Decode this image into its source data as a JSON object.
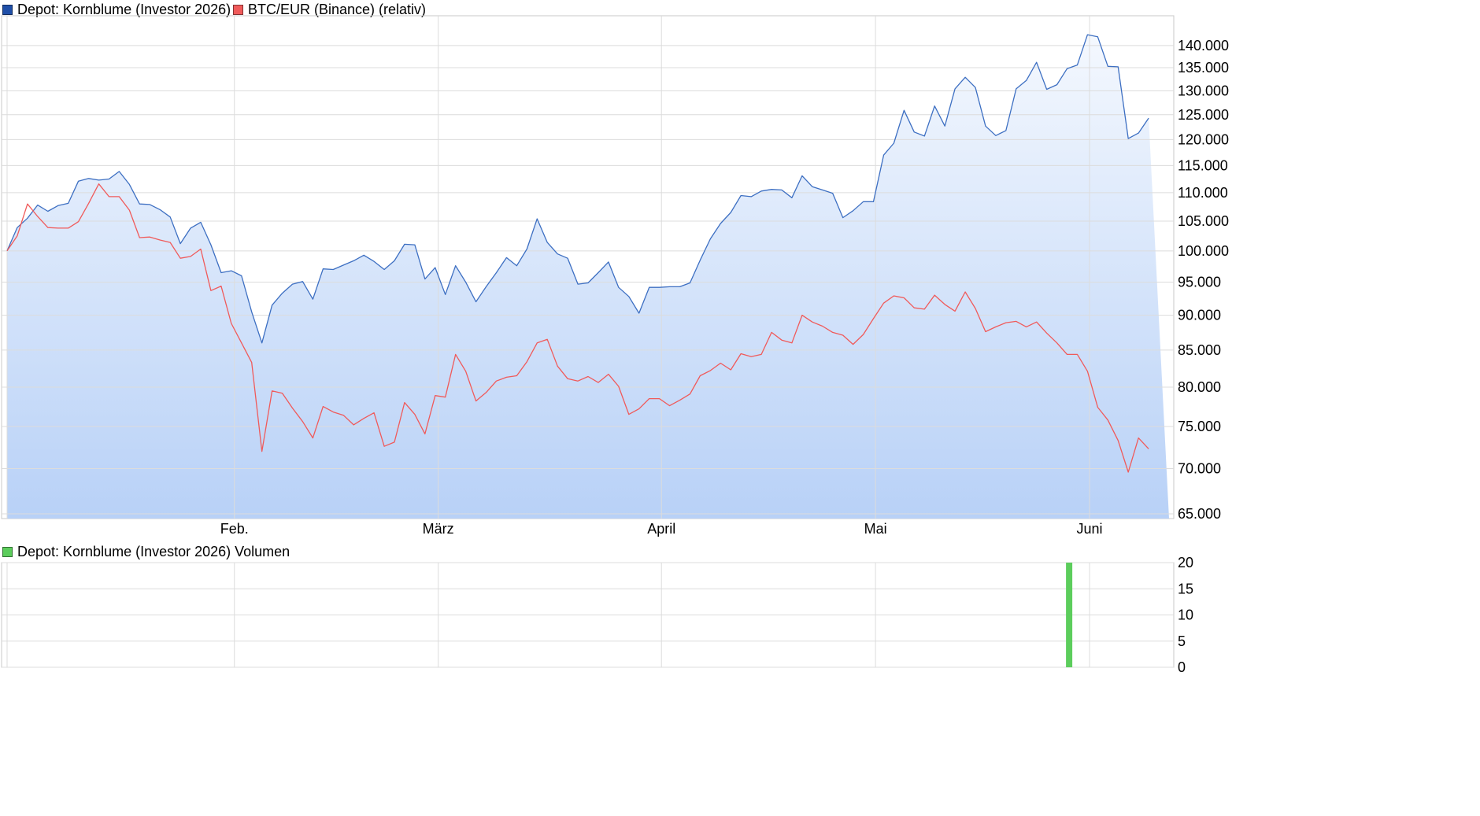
{
  "legend": {
    "depot": {
      "label": "Depot: Kornblume (Investor 2026)",
      "color": "#1f4fa8"
    },
    "btc": {
      "label": "BTC/EUR (Binance) (relativ)",
      "color": "#f05a5a"
    },
    "volume": {
      "label": "Depot: Kornblume (Investor 2026) Volumen",
      "color": "#5ccd5c"
    }
  },
  "chart_data": [
    {
      "type": "line",
      "scale": "log",
      "ylim": [
        64500,
        147000
      ],
      "y_ticks": [
        "140.000",
        "135.000",
        "130.000",
        "125.000",
        "120.000",
        "115.000",
        "110.000",
        "105.000",
        "100.000",
        "95.000",
        "90.000",
        "85.000",
        "80.000",
        "75.000",
        "70.000",
        "65.000"
      ],
      "y_tick_values": [
        140000,
        135000,
        130000,
        125000,
        120000,
        115000,
        110000,
        105000,
        100000,
        95000,
        90000,
        85000,
        80000,
        75000,
        70000,
        65000
      ],
      "x_ticks": [
        "Feb.",
        "März",
        "April",
        "Mai",
        "Juni"
      ],
      "x_tick_index": [
        22.3,
        42.3,
        64.2,
        85.2,
        106.2
      ],
      "x_count": 115,
      "grid": true,
      "series": [
        {
          "name": "Depot: Kornblume (Investor 2026)",
          "color": "#3d6fc2",
          "fill": true,
          "values": [
            100000,
            103900,
            105500,
            107800,
            106700,
            107700,
            108100,
            112100,
            112600,
            112300,
            112500,
            113900,
            111500,
            108000,
            107900,
            107000,
            105700,
            101200,
            103800,
            104800,
            101000,
            96500,
            96800,
            96000,
            90500,
            86000,
            91500,
            93300,
            94700,
            95100,
            92400,
            97100,
            97000,
            97700,
            98400,
            99300,
            98300,
            97000,
            98400,
            101100,
            101000,
            95500,
            97300,
            93100,
            97600,
            95000,
            92000,
            94300,
            96500,
            98900,
            97600,
            100300,
            105400,
            101400,
            99500,
            98800,
            94700,
            94900,
            96500,
            98200,
            94200,
            92800,
            90300,
            94200,
            94200,
            94300,
            94300,
            94900,
            98500,
            102000,
            104600,
            106500,
            109500,
            109300,
            110300,
            110600,
            110500,
            109100,
            113100,
            111100,
            110500,
            109900,
            105600,
            106800,
            108400,
            108400,
            117000,
            119300,
            125900,
            121500,
            120700,
            126800,
            122700,
            130400,
            132900,
            130700,
            122700,
            120800,
            121800,
            130400,
            132200,
            136200,
            130300,
            131300,
            134800,
            135600,
            142500,
            142000,
            135300,
            135200,
            120200,
            121300,
            124300
          ]
        },
        {
          "name": "BTC/EUR (Binance) (relativ)",
          "color": "#f05a5a",
          "fill": false,
          "values": [
            100000,
            102500,
            108000,
            105800,
            103900,
            103800,
            103800,
            104900,
            108100,
            111600,
            109300,
            109300,
            106900,
            102200,
            102300,
            101800,
            101400,
            98800,
            99100,
            100300,
            93700,
            94400,
            88800,
            86000,
            83300,
            72000,
            79500,
            79200,
            77300,
            75600,
            73600,
            77500,
            76800,
            76400,
            75200,
            76000,
            76700,
            72600,
            73100,
            78000,
            76500,
            74100,
            78900,
            78700,
            84400,
            82100,
            78200,
            79300,
            80800,
            81300,
            81500,
            83400,
            86000,
            86500,
            82800,
            81100,
            80800,
            81400,
            80600,
            81700,
            80100,
            76500,
            77200,
            78500,
            78500,
            77600,
            78300,
            79100,
            81500,
            82200,
            83200,
            82300,
            84500,
            84100,
            84400,
            87500,
            86400,
            86000,
            90000,
            89000,
            88400,
            87500,
            87100,
            85800,
            87200,
            89500,
            91800,
            92900,
            92600,
            91100,
            90900,
            93000,
            91600,
            90600,
            93500,
            91000,
            87600,
            88300,
            88900,
            89100,
            88300,
            89000,
            87400,
            86000,
            84400,
            84400,
            82100,
            77400,
            75800,
            73300,
            69600,
            73600,
            72300
          ]
        }
      ]
    },
    {
      "type": "bar",
      "ylim": [
        0,
        20
      ],
      "y_ticks": [
        "20",
        "15",
        "10",
        "5",
        "0"
      ],
      "y_tick_values": [
        20,
        15,
        10,
        5,
        0
      ],
      "x_count": 115,
      "grid": true,
      "series": [
        {
          "name": "Depot: Kornblume (Investor 2026) Volumen",
          "color": "#5ccd5c",
          "bars": [
            {
              "index": 104.2,
              "value": 20
            }
          ]
        }
      ]
    }
  ]
}
